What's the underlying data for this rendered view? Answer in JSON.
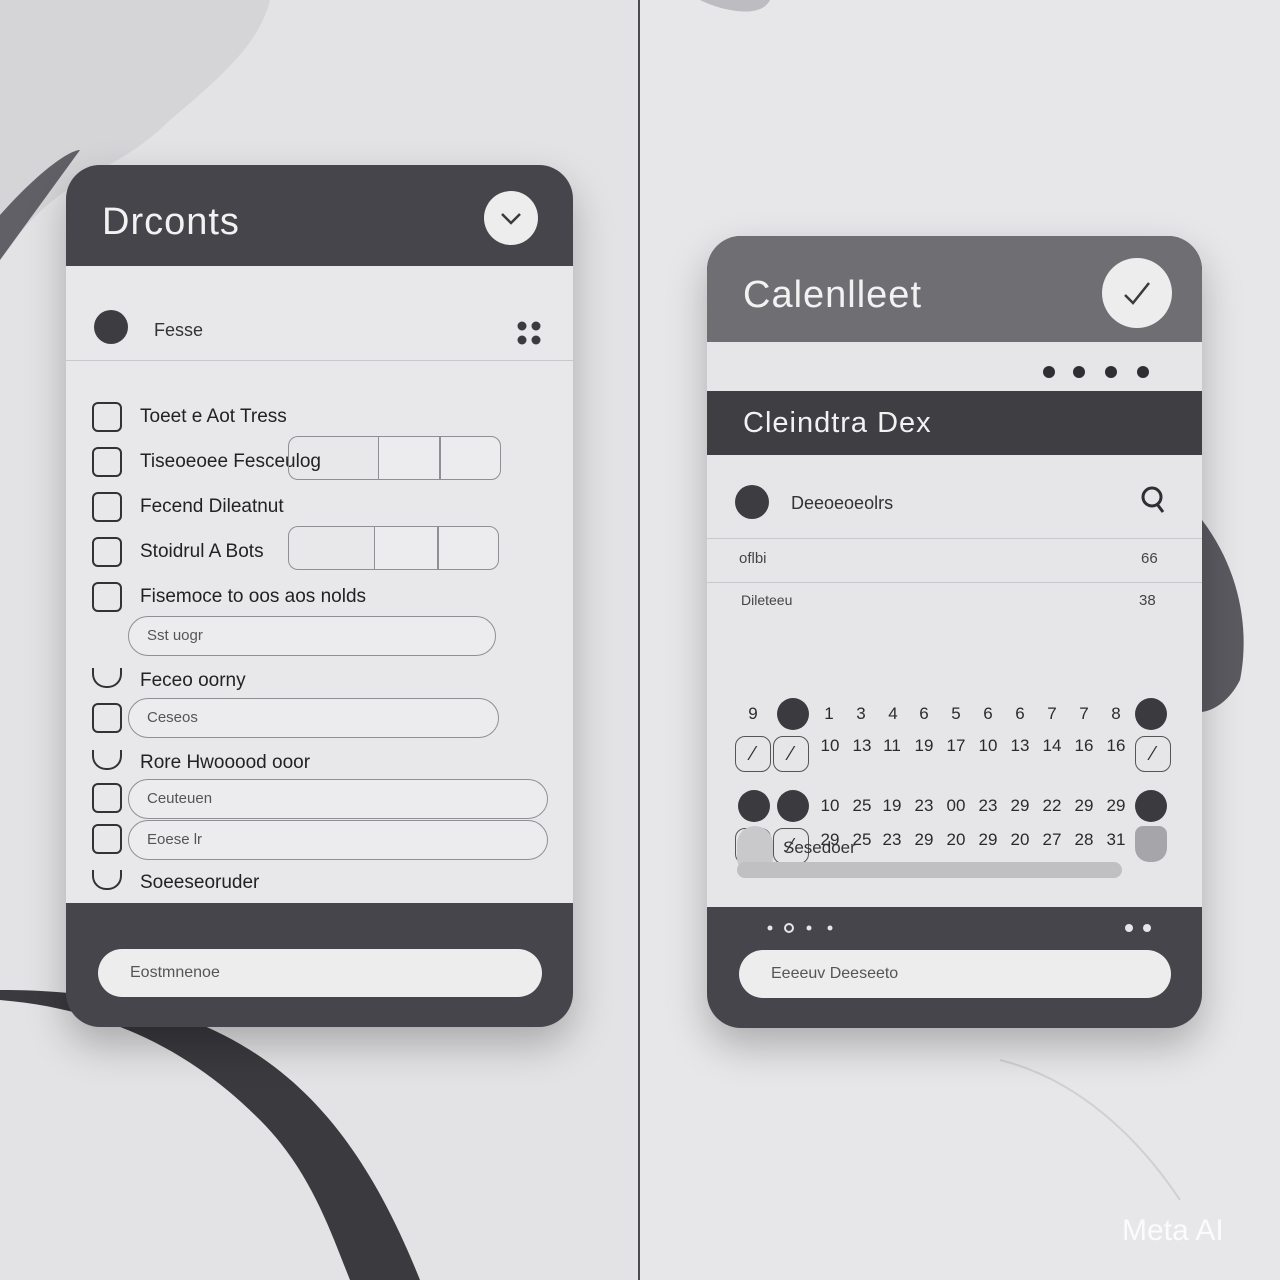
{
  "left_card": {
    "title": "Drconts",
    "check_icon": "check-icon",
    "section_label": "Fesse",
    "tasks": [
      {
        "label": "Toeet e Aot Tress",
        "type": "box"
      },
      {
        "label": "Tiseoeoee Fesceulog",
        "type": "box"
      },
      {
        "label": "Fecend Dileatnut",
        "type": "box"
      },
      {
        "label": "Stoidrul A Bots",
        "type": "box"
      },
      {
        "label": "Fisemoce to oos aos nolds",
        "type": "box"
      },
      {
        "label": "Feceo oorny",
        "type": "hook"
      },
      {
        "label": "",
        "type": "box"
      },
      {
        "label": "Rore Hwooood ooor",
        "type": "hook"
      },
      {
        "label": "",
        "type": "box"
      },
      {
        "label": "",
        "type": "box"
      },
      {
        "label": "Soeeseoruder",
        "type": "hook"
      }
    ],
    "pill_1": "Sst uogr",
    "pill_2": "Ceseos",
    "pill_3": "Ceuteuen",
    "pill_4": "Eoese lr",
    "footer_button": "Eostmnenoe"
  },
  "right_card": {
    "title": "Calenlleet",
    "check_icon": "check-icon",
    "subheader": "Cleindtra Dex",
    "section_label": "Deeoeoeolrs",
    "search_icon": "search-icon",
    "row1_left": "oflbi",
    "row1_right": "66",
    "row2_left": "Dileteeu",
    "row2_right": "38",
    "week1": [
      "9",
      "1",
      "3",
      "4",
      "6",
      "5",
      "6",
      "6",
      "7",
      "7",
      "8"
    ],
    "week2": [
      "10",
      "13",
      "11",
      "19",
      "17",
      "10",
      "13",
      "14",
      "16",
      "16"
    ],
    "week3": [
      "10",
      "25",
      "19",
      "23",
      "00",
      "23",
      "29",
      "22",
      "29",
      "29"
    ],
    "week4": [
      "29",
      "25",
      "23",
      "29",
      "20",
      "29",
      "20",
      "27",
      "28",
      "31"
    ],
    "schedule_label": "Sesedoer",
    "footer_button": "Eeeeuv Deeseeto"
  },
  "watermark": "Meta AI"
}
